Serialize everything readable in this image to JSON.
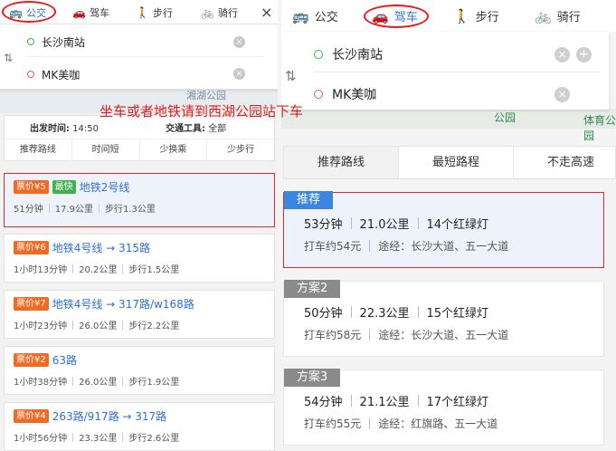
{
  "left": {
    "mode_tabs": [
      {
        "label": "公交",
        "icon": "bus-icon",
        "active": true
      },
      {
        "label": "驾车",
        "icon": "car-icon",
        "active": false
      },
      {
        "label": "步行",
        "icon": "walk-icon",
        "active": false
      },
      {
        "label": "骑行",
        "icon": "bike-icon",
        "active": false
      }
    ],
    "origin": "长沙南站",
    "destination": "MK美咖",
    "map_label": "湘湖公园",
    "filter": {
      "depart_label": "出发时间:",
      "depart_value": "14:50",
      "tool_label": "交通工具:",
      "tool_value": "全部",
      "options": [
        "推荐路线",
        "时间短",
        "少换乘",
        "少步行"
      ]
    },
    "routes": [
      {
        "price": "票价¥5",
        "tag": "最快",
        "name": "地铁2号线",
        "time": "51分钟",
        "distance": "17.9公里",
        "walk": "步行1.3公里"
      },
      {
        "price": "票价¥6",
        "name": "地铁4号线 → 315路",
        "time": "1小时13分钟",
        "distance": "20.2公里",
        "walk": "步行1.5公里"
      },
      {
        "price": "票价¥7",
        "name": "地铁4号线 → 317路/w168路",
        "time": "1小时23分钟",
        "distance": "26.0公里",
        "walk": "步行2.2公里"
      },
      {
        "price": "票价¥2",
        "name": "63路",
        "time": "1小时38分钟",
        "distance": "26.0公里",
        "walk": "步行1.9公里"
      },
      {
        "price": "票价¥4",
        "name": "263路/917路 → 317路",
        "time": "1小时56分钟",
        "distance": "23.3公里",
        "walk": "步行2.6公里"
      }
    ]
  },
  "close_icon": "×",
  "caption": "坐车或者地铁请到西湖公园站下车",
  "right": {
    "mode_tabs": [
      {
        "label": "公交",
        "icon": "bus-icon",
        "active": false
      },
      {
        "label": "驾车",
        "icon": "car-icon",
        "active": true
      },
      {
        "label": "步行",
        "icon": "walk-icon",
        "active": false
      },
      {
        "label": "骑行",
        "icon": "bike-icon",
        "active": false
      }
    ],
    "origin": "长沙南站",
    "destination": "MK美咖",
    "map_labels": [
      "公园",
      "体育公园"
    ],
    "tabs": [
      "推荐路线",
      "最短路程",
      "不走高速"
    ],
    "plans": [
      {
        "tag": "推荐",
        "time": "53分钟",
        "distance": "21.0公里",
        "lights": "14个红绿灯",
        "taxi": "打车约54元",
        "via": "途经：长沙大道、五一大道"
      },
      {
        "tag": "方案2",
        "time": "50分钟",
        "distance": "22.3公里",
        "lights": "15个红绿灯",
        "taxi": "打车约58元",
        "via": "途经：长沙大道、五一大道"
      },
      {
        "tag": "方案3",
        "time": "54分钟",
        "distance": "21.1公里",
        "lights": "17个红绿灯",
        "taxi": "打车约55元",
        "via": "途经：红旗路、五一大道"
      }
    ]
  },
  "colors": {
    "accent_blue": "#2e6fd8",
    "price_orange": "#f06a23",
    "fastest_green": "#3fb24a",
    "annotation_red": "#e41e1e"
  }
}
